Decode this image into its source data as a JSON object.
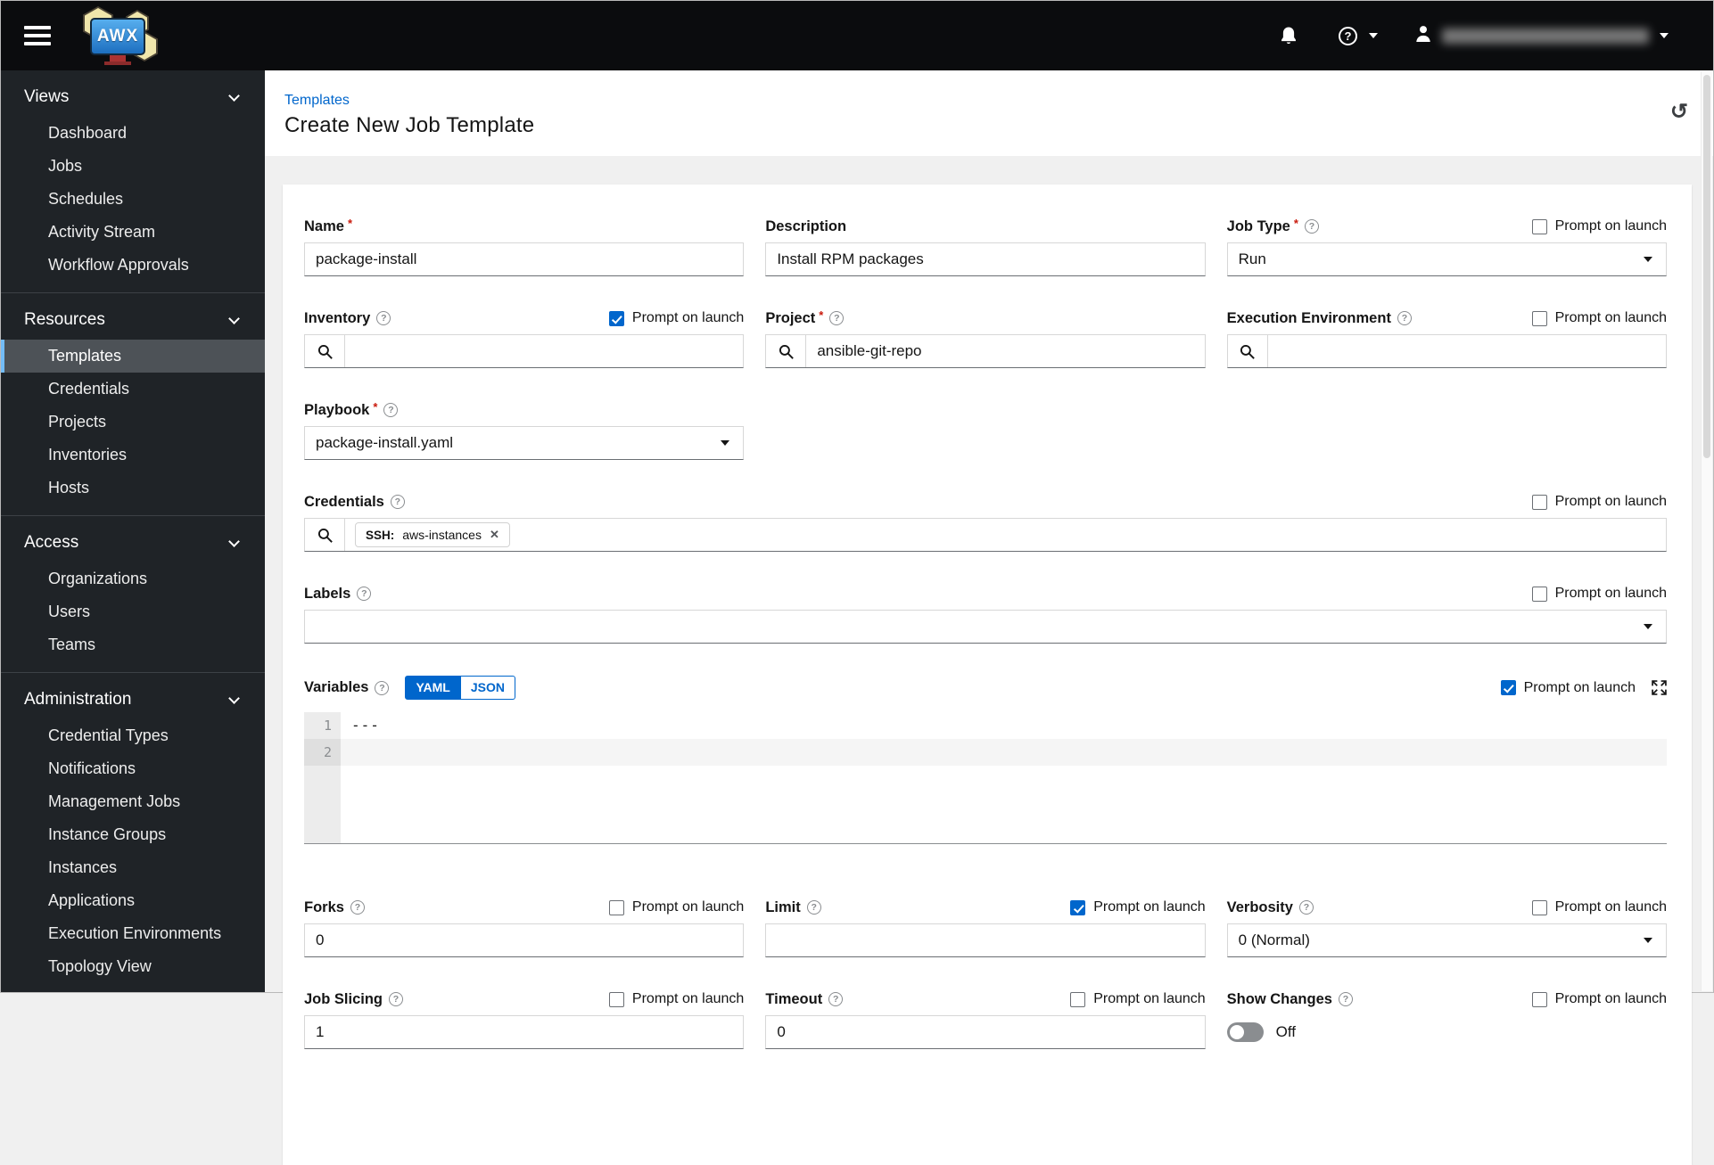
{
  "topbar": {
    "brand": "AWX"
  },
  "icons": {
    "close": "✕",
    "history": "↺"
  },
  "sidebar": {
    "sections": [
      {
        "label": "Views",
        "items": [
          "Dashboard",
          "Jobs",
          "Schedules",
          "Activity Stream",
          "Workflow Approvals"
        ]
      },
      {
        "label": "Resources",
        "items": [
          "Templates",
          "Credentials",
          "Projects",
          "Inventories",
          "Hosts"
        ],
        "active_item": "Templates"
      },
      {
        "label": "Access",
        "items": [
          "Organizations",
          "Users",
          "Teams"
        ]
      },
      {
        "label": "Administration",
        "items": [
          "Credential Types",
          "Notifications",
          "Management Jobs",
          "Instance Groups",
          "Instances",
          "Applications",
          "Execution Environments",
          "Topology View"
        ]
      }
    ]
  },
  "header": {
    "breadcrumb": "Templates",
    "title": "Create New Job Template"
  },
  "form": {
    "prompt_label": "Prompt on launch",
    "required_marker": "*",
    "name": {
      "label": "Name",
      "value": "package-install",
      "required": true
    },
    "description": {
      "label": "Description",
      "value": "Install RPM packages"
    },
    "job_type": {
      "label": "Job Type",
      "value": "Run",
      "required": true,
      "prompt_on_launch": false
    },
    "inventory": {
      "label": "Inventory",
      "value": "",
      "prompt_on_launch": true
    },
    "project": {
      "label": "Project",
      "value": "ansible-git-repo",
      "required": true
    },
    "execution_environment": {
      "label": "Execution Environment",
      "value": "",
      "prompt_on_launch": false
    },
    "playbook": {
      "label": "Playbook",
      "value": "package-install.yaml",
      "required": true
    },
    "credentials": {
      "label": "Credentials",
      "prompt_on_launch": false,
      "selected": [
        {
          "type_label": "SSH:",
          "name": "aws-instances"
        }
      ]
    },
    "labels": {
      "label": "Labels",
      "value": "",
      "prompt_on_launch": false
    },
    "variables": {
      "label": "Variables",
      "prompt_on_launch": true,
      "format_tabs": [
        "YAML",
        "JSON"
      ],
      "active_format": "YAML",
      "lines": [
        {
          "num": "1",
          "text": "---"
        },
        {
          "num": "2",
          "text": ""
        }
      ]
    },
    "forks": {
      "label": "Forks",
      "value": "0",
      "prompt_on_launch": false
    },
    "limit": {
      "label": "Limit",
      "value": "",
      "prompt_on_launch": true
    },
    "verbosity": {
      "label": "Verbosity",
      "value": "0 (Normal)",
      "prompt_on_launch": false
    },
    "job_slicing": {
      "label": "Job Slicing",
      "value": "1",
      "prompt_on_launch": false
    },
    "timeout": {
      "label": "Timeout",
      "value": "0",
      "prompt_on_launch": false
    },
    "show_changes": {
      "label": "Show Changes",
      "state": "Off",
      "prompt_on_launch": false
    }
  }
}
